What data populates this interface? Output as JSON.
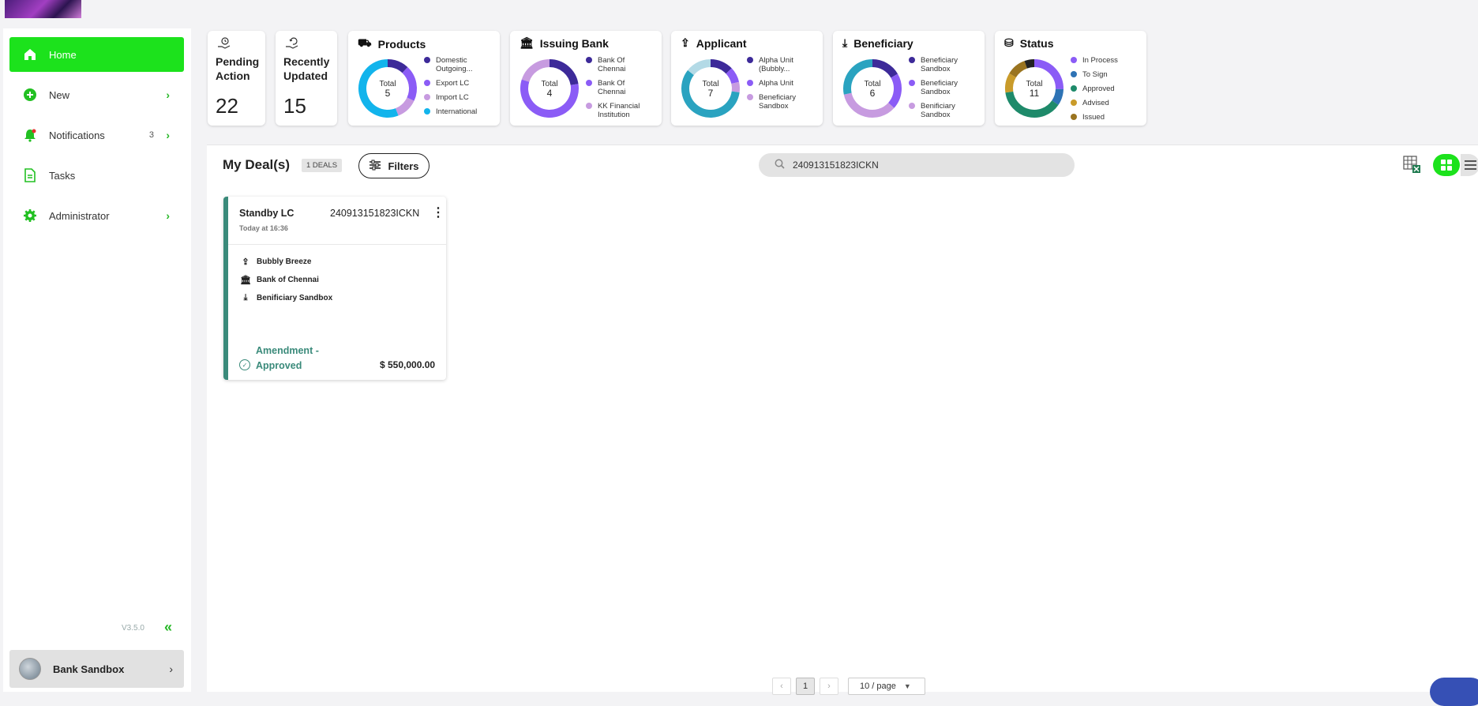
{
  "nav": {
    "home": "Home",
    "new": "New",
    "notifications": "Notifications",
    "notifications_count": "3",
    "tasks": "Tasks",
    "administrator": "Administrator",
    "chevron": "›"
  },
  "sidebar_footer": {
    "version": "V3.5.0",
    "collapse": "«",
    "user_name": "Bank Sandbox",
    "chevron": "›"
  },
  "summary": {
    "pending": {
      "label_1": "Pending",
      "label_2": "Action",
      "value": "22"
    },
    "recent": {
      "label_1": "Recently",
      "label_2": "Updated",
      "value": "15"
    },
    "products": {
      "title": "Products",
      "total_label": "Total",
      "total": "5",
      "legend": [
        "Domestic Outgoing...",
        "Export LC",
        "Import LC",
        "International"
      ],
      "colors": [
        "#3d2a99",
        "#8b5cf6",
        "#c79be0",
        "#12b4ec"
      ],
      "values": [
        0.6,
        1,
        0.6,
        2.8
      ]
    },
    "issuing_bank": {
      "title": "Issuing Bank",
      "total_label": "Total",
      "total": "4",
      "legend": [
        "Bank Of Chennai",
        "Bank Of Chennai",
        "KK Financial Institution"
      ],
      "colors": [
        "#3d2a99",
        "#8b5cf6",
        "#c79be0"
      ],
      "values": [
        0.9,
        2.3,
        0.8
      ]
    },
    "applicant": {
      "title": "Applicant",
      "total_label": "Total",
      "total": "7",
      "legend": [
        "Alpha Unit (Bubbly...",
        "Alpha Unit",
        "Beneficiary Sandbox"
      ],
      "colors": [
        "#3d2a99",
        "#8b5cf6",
        "#c79be0",
        "#2aa3c0",
        "#b3dae6"
      ],
      "values": [
        0.9,
        0.6,
        0.4,
        4.1,
        1.0
      ]
    },
    "beneficiary": {
      "title": "Beneficiary",
      "total_label": "Total",
      "total": "6",
      "legend": [
        "Beneficiary Sandbox",
        "Beneficiary Sandbox",
        "Benificiary Sandbox"
      ],
      "colors": [
        "#3d2a99",
        "#8b5cf6",
        "#c79be0",
        "#2aa3c0"
      ],
      "values": [
        1,
        1.2,
        2.1,
        1.7
      ]
    },
    "status": {
      "title": "Status",
      "total_label": "Total",
      "total": "11",
      "legend": [
        "In Process",
        "To Sign",
        "Approved",
        "Advised",
        "Issued"
      ],
      "colors": [
        "#8b5cf6",
        "#2e73b5",
        "#1e8a6a",
        "#c99b2a",
        "#9a7420",
        "#222222"
      ],
      "values": [
        2.8,
        1.0,
        4.2,
        1.2,
        1.2,
        0.6
      ]
    }
  },
  "main": {
    "title": "My Deal(s)",
    "deals_badge": "1 DEALS",
    "filters_label": "Filters",
    "search_value": "240913151823ICKN"
  },
  "deal": {
    "type": "Standby LC",
    "reference": "240913151823ICKN",
    "time": "Today at 16:36",
    "applicant": "Bubbly Breeze",
    "issuing_bank": "Bank of Chennai",
    "beneficiary": "Benificiary Sandbox",
    "status": "Amendment - Approved",
    "amount": "$ 550,000.00"
  },
  "pagination": {
    "prev": "‹",
    "current": "1",
    "next": "›",
    "page_size": "10 / page"
  },
  "icons": {
    "home": "home-icon",
    "new": "plus-circle-icon",
    "notifications": "bell-icon",
    "tasks": "document-icon",
    "admin": "gear-icon",
    "search": "search-icon",
    "filters": "sliders-icon",
    "excel": "excel-icon",
    "grid": "grid-icon",
    "list": "list-icon"
  }
}
